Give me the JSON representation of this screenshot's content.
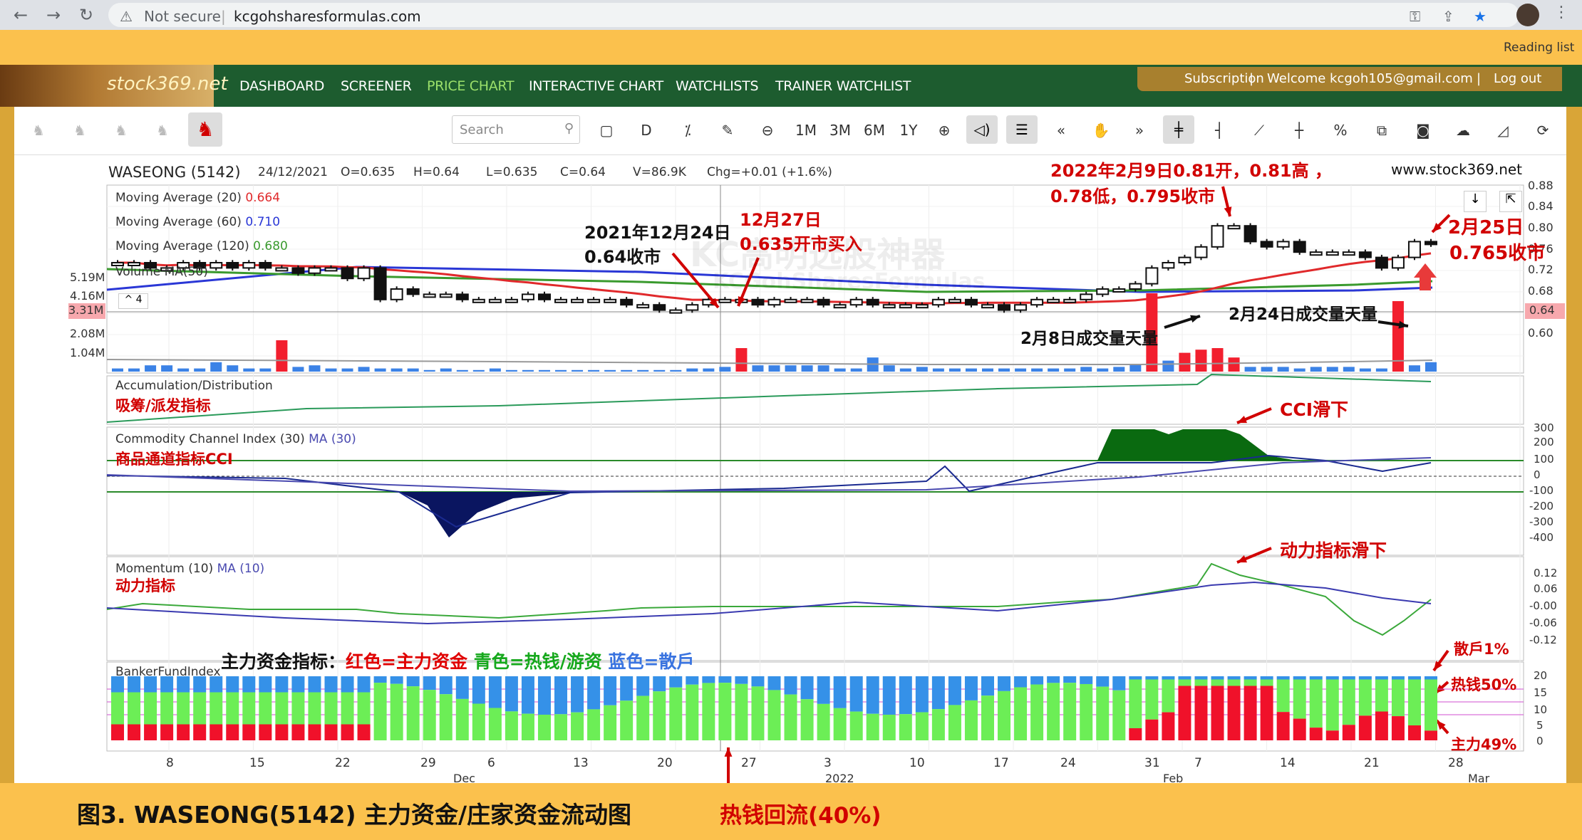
{
  "browser": {
    "url": "kcgohsharesformulas.com",
    "security": "Not secure",
    "reading_list": "Reading list"
  },
  "nav": {
    "logo": "stock369.net",
    "items": [
      "DASHBOARD",
      "SCREENER",
      "PRICE CHART",
      "INTERACTIVE CHART",
      "WATCHLISTS",
      "TRAINER WATCHLIST"
    ],
    "active": "PRICE CHART",
    "subscription": "Subscription",
    "welcome": "Welcome kcgoh105@gmail.com",
    "logout": "Log out"
  },
  "toolbar": {
    "search_placeholder": "Search",
    "buttons": [
      "D",
      "1M",
      "3M",
      "6M",
      "1Y"
    ]
  },
  "header": {
    "symbol": "WASEONG (5142)",
    "date": "24/12/2021",
    "open": "O=0.635",
    "high": "H=0.64",
    "low": "L=0.635",
    "close": "C=0.64",
    "volume": "V=86.9K",
    "change": "Chg=+0.01 (+1.6%)",
    "site": "www.stock369.net"
  },
  "ma": [
    {
      "label": "Moving Average (20)",
      "value": "0.664",
      "color": "#e0292b"
    },
    {
      "label": "Moving Average (60)",
      "value": "0.710",
      "color": "#2a37d6"
    },
    {
      "label": "Moving Average (120)",
      "value": "0.680",
      "color": "#3a9a2e"
    }
  ],
  "volume": {
    "label": "Volume MA(50)",
    "collapse": "^ 4",
    "axis": [
      "5.19M",
      "4.16M",
      "3.31M",
      "2.08M",
      "1.04M"
    ]
  },
  "price_axis": [
    "0.88",
    "0.84",
    "0.80",
    "0.76",
    "0.72",
    "0.68",
    "0.64",
    "0.60"
  ],
  "price_badge": "0.64",
  "volume_badge": "3.31M",
  "watermark": "KC高明选股神器",
  "watermark2": "KCGohSharesFormulas",
  "panels": {
    "ad": {
      "label": "Accumulation/Distribution",
      "cn": "吸筹/派发指标"
    },
    "cci": {
      "label": "Commodity Channel Index (30)",
      "ma": "MA (30)",
      "cn": "商品通道指标CCI",
      "axis": [
        "300",
        "200",
        "100",
        "0",
        "-100",
        "-200",
        "-300",
        "-400"
      ]
    },
    "mom": {
      "label": "Momentum (10)",
      "ma": "MA (10)",
      "cn": "动力指标",
      "axis": [
        "0.12",
        "0.06",
        "-0.00",
        "-0.06",
        "-0.12"
      ]
    },
    "bfi": {
      "label": "BankerFundIndex",
      "legend_title": "主力资金指标：",
      "legend_red": "红色=主力资金",
      "legend_green": "青色=热钱/游资",
      "legend_blue": "蓝色=散戶",
      "axis": [
        "20",
        "15",
        "10",
        "5",
        "0"
      ]
    }
  },
  "xaxis": {
    "ticks": [
      "8",
      "15",
      "22",
      "29",
      "6",
      "13",
      "20",
      "27",
      "3",
      "10",
      "17",
      "24",
      "31",
      "7",
      "14",
      "21",
      "28"
    ],
    "months": [
      "Dec",
      "2022",
      "Feb",
      "Mar"
    ]
  },
  "annotations": {
    "a1": "2021年12月24日",
    "a1b": "0.64收市",
    "a2": "12月27日",
    "a2b": "0.635开市买入",
    "a3": "2022年2月9日0.81开，0.81高 ，",
    "a3b": "0.78低，0.795收市",
    "a4": "2月25日",
    "a4b": "0.765收市",
    "a5": "2月8日成交量天量",
    "a6": "2月24日成交量天量",
    "a7": "CCI滑下",
    "a8": "动力指标滑下",
    "a9": "散戶1%",
    "a10": "热钱50%",
    "a11": "主力49%"
  },
  "caption": {
    "title": "图3. WASEONG(5142) 主力资金/庄家资金流动图",
    "hot_money": "热钱回流(40%)"
  },
  "chart_data": {
    "type": "candlestick",
    "symbol": "WASEONG (5142)",
    "series_note": "daily OHLC Nov 2021 - Feb 2022",
    "closes": [
      0.73,
      0.73,
      0.72,
      0.72,
      0.73,
      0.72,
      0.73,
      0.72,
      0.73,
      0.72,
      0.72,
      0.71,
      0.72,
      0.72,
      0.7,
      0.72,
      0.66,
      0.68,
      0.67,
      0.67,
      0.67,
      0.66,
      0.66,
      0.66,
      0.66,
      0.67,
      0.66,
      0.66,
      0.66,
      0.66,
      0.66,
      0.65,
      0.65,
      0.64,
      0.64,
      0.65,
      0.66,
      0.66,
      0.66,
      0.65,
      0.66,
      0.66,
      0.66,
      0.65,
      0.65,
      0.66,
      0.65,
      0.65,
      0.65,
      0.65,
      0.66,
      0.66,
      0.65,
      0.65,
      0.64,
      0.65,
      0.66,
      0.66,
      0.66,
      0.67,
      0.68,
      0.68,
      0.69,
      0.72,
      0.73,
      0.74,
      0.76,
      0.8,
      0.8,
      0.77,
      0.76,
      0.77,
      0.75,
      0.75,
      0.75,
      0.75,
      0.74,
      0.72,
      0.74,
      0.77,
      0.765
    ]
  }
}
